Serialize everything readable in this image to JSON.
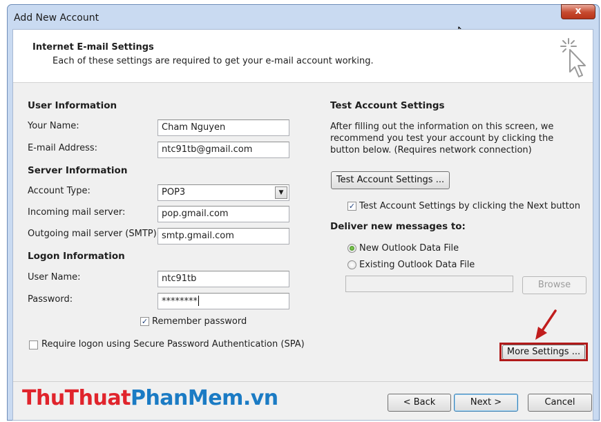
{
  "window": {
    "title": "Add New Account",
    "close_glyph": "x"
  },
  "header": {
    "title": "Internet E-mail Settings",
    "subtitle": "Each of these settings are required to get your e-mail account working."
  },
  "user_info": {
    "section": "User Information",
    "name_label": "Your Name:",
    "name_value": "Cham Nguyen",
    "email_label": "E-mail Address:",
    "email_value": "ntc91tb@gmail.com"
  },
  "server_info": {
    "section": "Server Information",
    "account_type_label": "Account Type:",
    "account_type_value": "POP3",
    "incoming_label": "Incoming mail server:",
    "incoming_value": "pop.gmail.com",
    "outgoing_label": "Outgoing mail server (SMTP):",
    "outgoing_value": "smtp.gmail.com"
  },
  "logon_info": {
    "section": "Logon Information",
    "username_label": "User Name:",
    "username_value": "ntc91tb",
    "password_label": "Password:",
    "password_value": "********",
    "remember_label": "Remember password",
    "remember_checked": true,
    "spa_label": "Require logon using Secure Password Authentication (SPA)",
    "spa_checked": false
  },
  "test_settings": {
    "section": "Test Account Settings",
    "description": "After filling out the information on this screen, we recommend you test your account by clicking the button below. (Requires network connection)",
    "test_button": "Test Account Settings ...",
    "test_next_label": "Test Account Settings by clicking the Next button",
    "test_next_checked": true
  },
  "deliver": {
    "section": "Deliver new messages to:",
    "option_new": "New Outlook Data File",
    "option_existing": "Existing Outlook Data File",
    "selected": "New Outlook Data File",
    "existing_path": "",
    "browse_button": "Browse"
  },
  "more_settings_button": "More Settings ...",
  "footer": {
    "back_button": "< Back",
    "next_button": "Next >",
    "cancel_button": "Cancel"
  },
  "watermark": {
    "part1": "ThuThuat",
    "part2": "PhanMem.vn",
    "color1": "#e0242c",
    "color2": "#1b7bc4"
  },
  "colors": {
    "highlight_border": "#b11a1a",
    "arrow": "#c11d1d"
  }
}
